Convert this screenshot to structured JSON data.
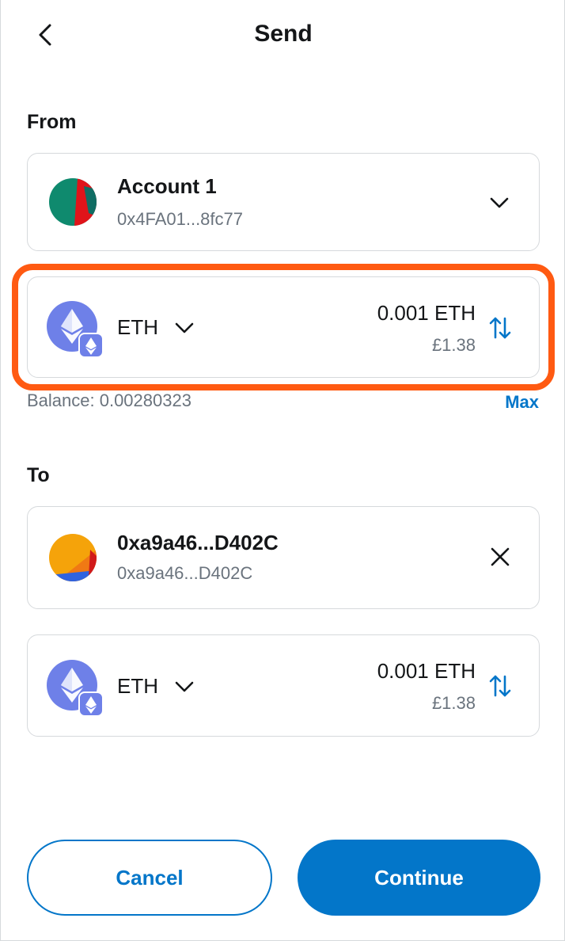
{
  "header": {
    "title": "Send",
    "back_icon": "chevron-left-icon"
  },
  "from": {
    "label": "From",
    "account_name": "Account 1",
    "account_address": "0x4FA01...8fc77",
    "dropdown_icon": "chevron-down-icon"
  },
  "asset": {
    "symbol": "ETH",
    "amount": "0.001 ETH",
    "fiat": "£1.38",
    "icon": "eth-icon",
    "swap_icon": "swap-vertical-icon"
  },
  "balance": {
    "text": "Balance: 0.00280323",
    "max_label": "Max"
  },
  "to": {
    "label": "To",
    "recipient_name": "0xa9a46...D402C",
    "recipient_address": "0xa9a46...D402C",
    "clear_icon": "close-icon"
  },
  "receive_asset": {
    "symbol": "ETH",
    "amount": "0.001 ETH",
    "fiat": "£1.38"
  },
  "buttons": {
    "cancel": "Cancel",
    "continue": "Continue"
  },
  "colors": {
    "primary": "#0376c9",
    "highlight": "#ff5a12",
    "eth": "#6e80e8",
    "muted": "#6a737d",
    "border": "#d6d9dc"
  }
}
